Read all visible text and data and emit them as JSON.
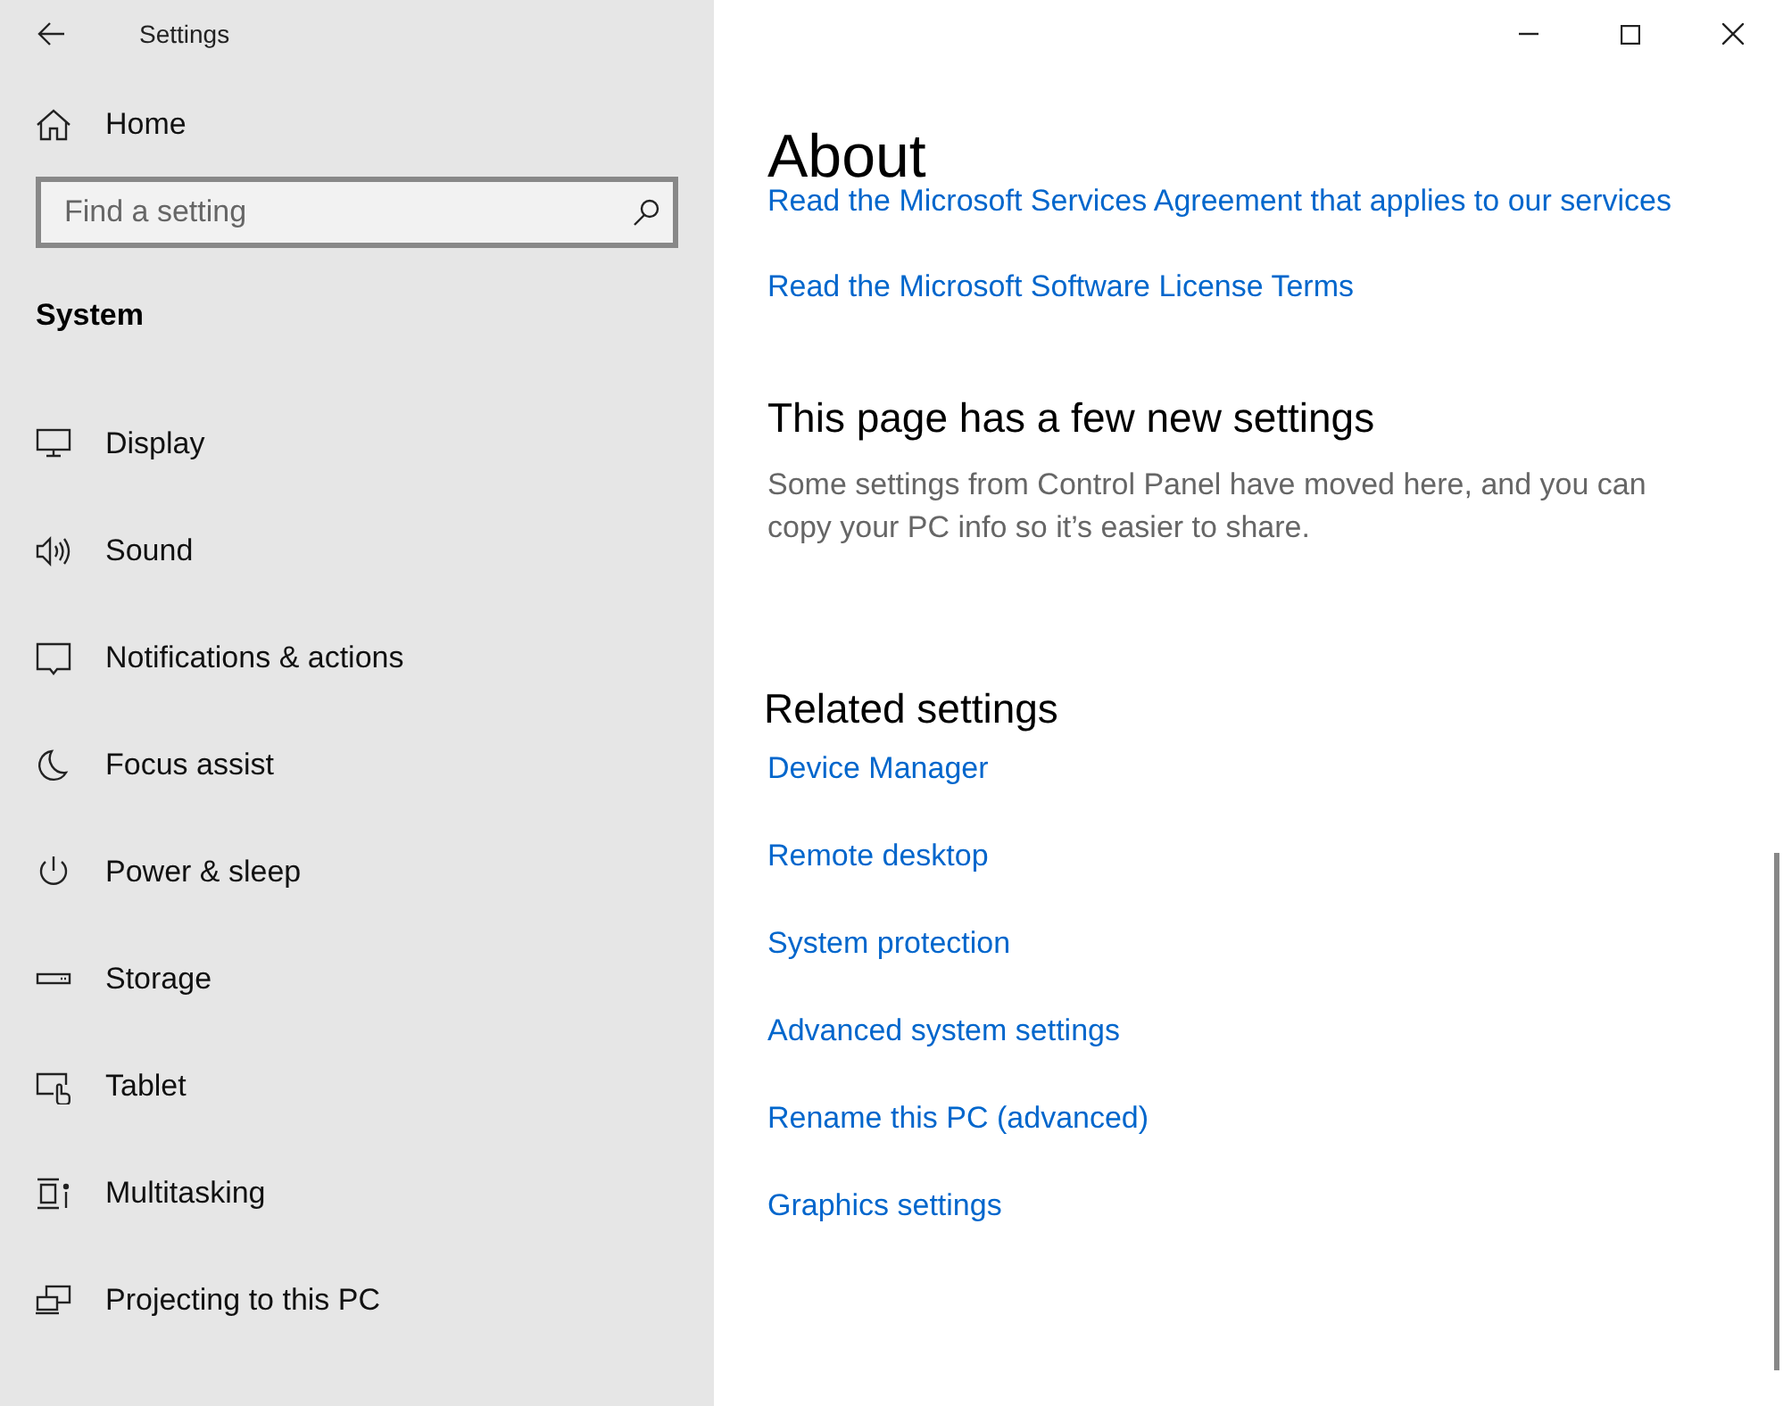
{
  "window": {
    "title": "Settings"
  },
  "sidebar": {
    "home": "Home",
    "search": {
      "placeholder": "Find a setting"
    },
    "section": "System",
    "items": [
      {
        "kind": "display",
        "label": "Display"
      },
      {
        "kind": "sound",
        "label": "Sound"
      },
      {
        "kind": "notifications",
        "label": "Notifications & actions"
      },
      {
        "kind": "focus",
        "label": "Focus assist"
      },
      {
        "kind": "power",
        "label": "Power & sleep"
      },
      {
        "kind": "storage",
        "label": "Storage"
      },
      {
        "kind": "tablet",
        "label": "Tablet"
      },
      {
        "kind": "multitasking",
        "label": "Multitasking"
      },
      {
        "kind": "projecting",
        "label": "Projecting to this PC"
      }
    ]
  },
  "content": {
    "title": "About",
    "top_links": [
      "Read the Microsoft Services Agreement that applies to our services",
      "Read the Microsoft Software License Terms"
    ],
    "notice": {
      "heading": "This page has a few new settings",
      "text": "Some settings from Control Panel have moved here, and you can copy your PC info so it’s easier to share."
    },
    "related": {
      "heading": "Related settings",
      "links": [
        "Device Manager",
        "Remote desktop",
        "System protection",
        "Advanced system settings",
        "Rename this PC (advanced)",
        "Graphics settings"
      ]
    }
  }
}
